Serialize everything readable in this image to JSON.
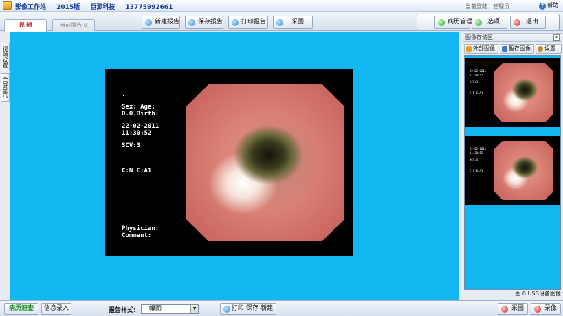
{
  "titlebar": {
    "app_name": "影像工作站",
    "version": "2015版",
    "company": "巨渺科技",
    "phone": "13775992661",
    "login_label": "当前登陆：管理员",
    "help_label": "帮助"
  },
  "tabs": [
    {
      "label": "视 频",
      "active": true
    },
    {
      "label": "当前报告 0",
      "active": false
    }
  ],
  "toolbar": {
    "new_report": "新建报告",
    "save_report": "保存报告",
    "print_report": "打印报告",
    "capture": "采图",
    "case_management": "病历管理",
    "options": "选项",
    "exit": "退出"
  },
  "left_tabs": [
    "视频设置",
    "全屏显示"
  ],
  "video_overlay": {
    "dot": ".",
    "sex_age": "Sex: Age:",
    "dob": "D.O.Birth:",
    "date": "22-02-2011",
    "time": "11:30:52",
    "scv": "SCV:3",
    "code": "C:N E:A1",
    "physician": "Physician:",
    "comment": "Comment:"
  },
  "right_panel": {
    "title": "图像存储区",
    "close_symbol": "x",
    "external_image": "外部图像",
    "temp_save_image": "暂存图像",
    "settings": "设置",
    "status_count": "图:0",
    "status_source": "USB设备图像",
    "thumbnails": [
      {
        "date": "22-02-2011",
        "time": "11:30:52",
        "scv": "SCV:3",
        "code": "C:N E:A1"
      },
      {
        "date": "22-02-2011",
        "time": "11:30:52",
        "scv": "SCV:3",
        "code": "C:N E:A1"
      }
    ]
  },
  "bottombar": {
    "case_quick_search": "病历速查",
    "info_entry": "信息录入",
    "report_style_label": "报告样式:",
    "report_style_value": "一幅图",
    "print_save_new": "打印-保存-新建",
    "capture": "采图",
    "record": "录像"
  },
  "colors": {
    "video_bg": "#12b7f1",
    "title_text": "#1a3f9a",
    "active_tab_text": "#cc2222"
  }
}
